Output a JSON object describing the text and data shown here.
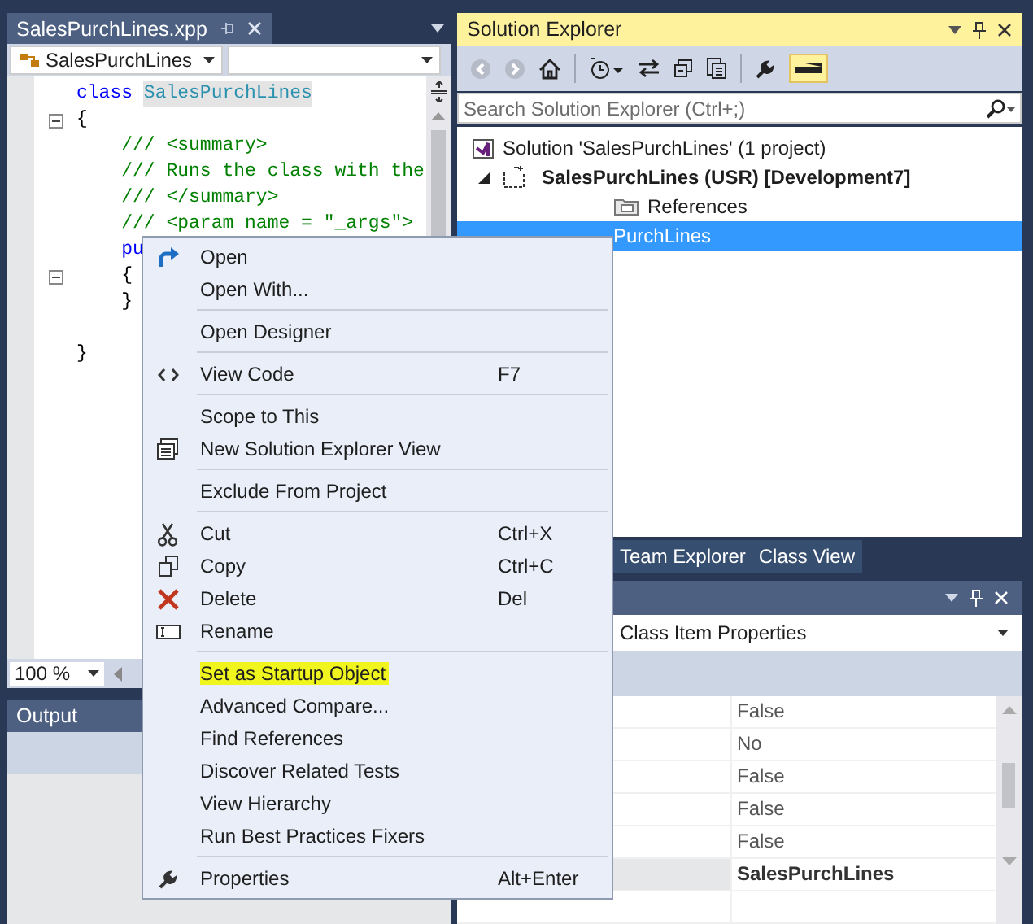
{
  "document": {
    "tab": "SalesPurchLines.xpp",
    "type_combo": "SalesPurchLines",
    "code_lines": [
      {
        "fold": false,
        "segments": [
          {
            "kind": "keyword",
            "text": "class "
          },
          {
            "kind": "reference",
            "text": "SalesPurchLines"
          }
        ]
      },
      {
        "fold": true,
        "segments": [
          {
            "kind": "plain",
            "text": "{"
          }
        ]
      },
      {
        "fold": false,
        "segments": [
          {
            "kind": "comment",
            "text": "    /// <summary>"
          }
        ]
      },
      {
        "fold": false,
        "segments": [
          {
            "kind": "comment",
            "text": "    /// Runs the class with the"
          }
        ]
      },
      {
        "fold": false,
        "segments": [
          {
            "kind": "comment",
            "text": "    /// </summary>"
          }
        ]
      },
      {
        "fold": false,
        "segments": [
          {
            "kind": "comment",
            "text": "    /// <param name = \"_args\">"
          }
        ]
      },
      {
        "fold": false,
        "segments": [
          {
            "kind": "keyword",
            "text": "    pu"
          }
        ]
      },
      {
        "fold": true,
        "segments": [
          {
            "kind": "plain",
            "text": "    {"
          }
        ]
      },
      {
        "fold": false,
        "segments": [
          {
            "kind": "plain",
            "text": "    }"
          }
        ]
      },
      {
        "fold": false
      },
      {
        "fold": false,
        "segments": [
          {
            "kind": "plain",
            "text": "}"
          }
        ]
      }
    ],
    "zoom": "100 %"
  },
  "output": {
    "title": "Output"
  },
  "solution_explorer": {
    "title": "Solution Explorer",
    "preview_button_on": true,
    "search": {
      "placeholder": "Search Solution Explorer (Ctrl+;)"
    },
    "tree": [
      {
        "label": "Solution 'SalesPurchLines' (1 project)",
        "selected": false,
        "children": [
          {
            "label": "SalesPurchLines (USR) [Development7]",
            "selected": false,
            "expanded": true,
            "children": [
              {
                "label": "References",
                "selected": false
              },
              {
                "label": "PurchLines",
                "selected": true
              }
            ]
          }
        ]
      }
    ]
  },
  "tool_tabs": [
    {
      "label": "Team Explorer",
      "selected": false
    },
    {
      "label": "Class View",
      "selected": false
    }
  ],
  "properties": {
    "object": "Class Item Properties",
    "rows": [
      {
        "value": "False",
        "selected": false,
        "modified": false
      },
      {
        "value": "No",
        "selected": false,
        "modified": false
      },
      {
        "value": "False",
        "selected": false,
        "modified": false
      },
      {
        "value": "False",
        "selected": false,
        "modified": false
      },
      {
        "value": "False",
        "selected": false,
        "modified": false
      },
      {
        "value": "SalesPurchLines",
        "selected": true,
        "modified": true
      }
    ]
  },
  "context_menu": [
    {
      "kind": "item",
      "label": "Open",
      "highlighted": false
    },
    {
      "kind": "item",
      "label": "Open With...",
      "highlighted": false
    },
    {
      "kind": "separator"
    },
    {
      "kind": "item",
      "label": "Open Designer",
      "highlighted": false
    },
    {
      "kind": "separator"
    },
    {
      "kind": "item",
      "label": "View Code",
      "shortcut": "F7",
      "highlighted": false
    },
    {
      "kind": "separator"
    },
    {
      "kind": "item",
      "label": "Scope to This",
      "highlighted": false
    },
    {
      "kind": "item",
      "label": "New Solution Explorer View",
      "highlighted": false
    },
    {
      "kind": "separator"
    },
    {
      "kind": "item",
      "label": "Exclude From Project",
      "highlighted": false
    },
    {
      "kind": "separator"
    },
    {
      "kind": "item",
      "label": "Cut",
      "shortcut": "Ctrl+X",
      "highlighted": false
    },
    {
      "kind": "item",
      "label": "Copy",
      "shortcut": "Ctrl+C",
      "highlighted": false
    },
    {
      "kind": "item",
      "label": "Delete",
      "shortcut": "Del",
      "highlighted": false
    },
    {
      "kind": "item",
      "label": "Rename",
      "highlighted": false
    },
    {
      "kind": "separator"
    },
    {
      "kind": "item",
      "label": "Set as Startup Object",
      "highlighted": true
    },
    {
      "kind": "item",
      "label": "Advanced Compare...",
      "highlighted": false
    },
    {
      "kind": "item",
      "label": "Find References",
      "highlighted": false
    },
    {
      "kind": "item",
      "label": "Discover Related Tests",
      "highlighted": false
    },
    {
      "kind": "item",
      "label": "View Hierarchy",
      "highlighted": false
    },
    {
      "kind": "item",
      "label": "Run Best Practices Fixers",
      "highlighted": false
    },
    {
      "kind": "separator"
    },
    {
      "kind": "item",
      "label": "Properties",
      "shortcut": "Alt+Enter",
      "highlighted": false
    }
  ]
}
